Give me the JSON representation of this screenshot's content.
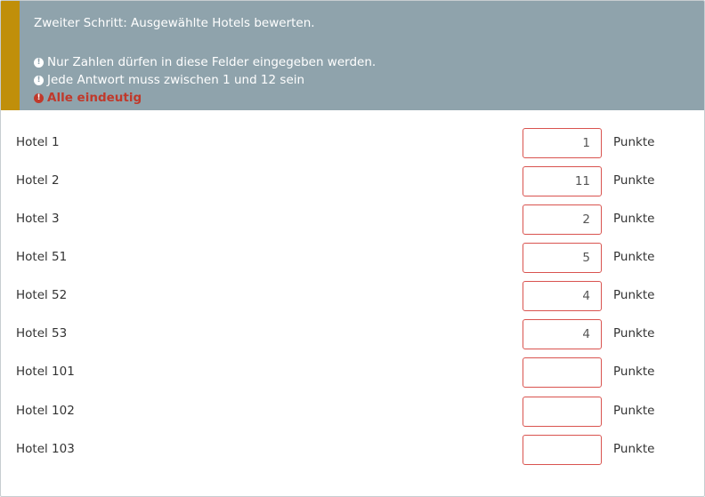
{
  "question": {
    "text": "Zweiter Schritt: Ausgewählte Hotels bewerten.",
    "tips": [
      "Nur Zahlen dürfen in diese Felder eingegeben werden.",
      "Jede Antwort muss zwischen 1 und 12 sein",
      "Alle eindeutig"
    ],
    "tip_icon": "!",
    "colors": {
      "header_bg": "#8fa3ac",
      "accent": "#c08f0a",
      "error": "#c0392b",
      "input_border_error": "#d9534f"
    }
  },
  "rows": [
    {
      "label": "Hotel 1",
      "value": "1",
      "suffix": "Punkte"
    },
    {
      "label": "Hotel 2",
      "value": "11",
      "suffix": "Punkte"
    },
    {
      "label": "Hotel 3",
      "value": "2",
      "suffix": "Punkte"
    },
    {
      "label": "Hotel 51",
      "value": "5",
      "suffix": "Punkte"
    },
    {
      "label": "Hotel 52",
      "value": "4",
      "suffix": "Punkte"
    },
    {
      "label": "Hotel 53",
      "value": "4",
      "suffix": "Punkte"
    },
    {
      "label": "Hotel 101",
      "value": "",
      "suffix": "Punkte"
    },
    {
      "label": "Hotel 102",
      "value": "",
      "suffix": "Punkte"
    },
    {
      "label": "Hotel 103",
      "value": "",
      "suffix": "Punkte"
    }
  ]
}
